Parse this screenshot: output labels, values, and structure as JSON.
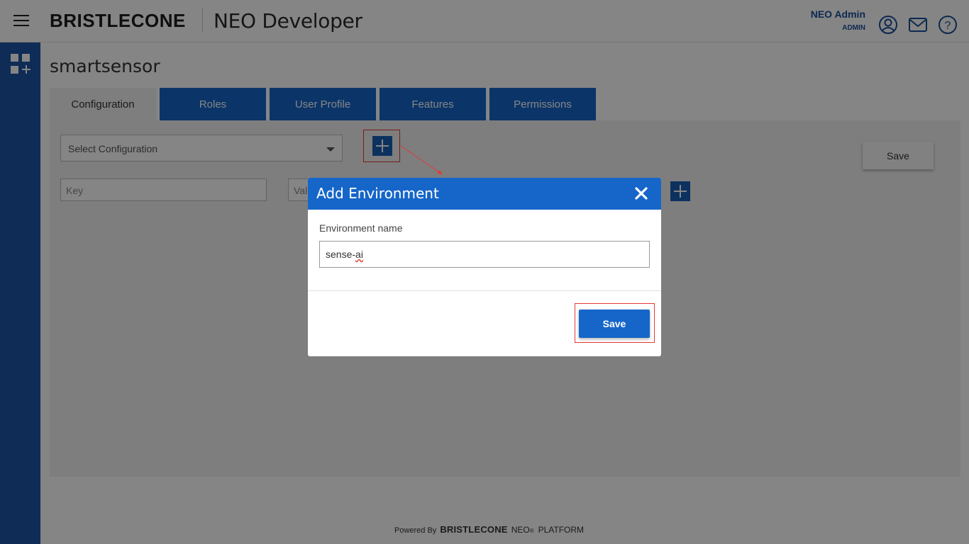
{
  "header": {
    "logo_text": "BRISTLECONE",
    "app_title": "NEO Developer",
    "user_name": "NEO Admin",
    "user_role": "ADMIN"
  },
  "page": {
    "title": "smartsensor",
    "tabs": [
      {
        "label": "Configuration",
        "active": true
      },
      {
        "label": "Roles",
        "active": false
      },
      {
        "label": "User Profile",
        "active": false
      },
      {
        "label": "Features",
        "active": false
      },
      {
        "label": "Permissions",
        "active": false
      }
    ],
    "select_placeholder": "Select Configuration",
    "save_label": "Save",
    "key_placeholder": "Key",
    "value_placeholder": "Val"
  },
  "modal": {
    "title": "Add Environment",
    "field_label": "Environment name",
    "field_value_prefix": "sense-",
    "field_value_misspelled": "ai",
    "save_label": "Save"
  },
  "footer": {
    "powered_by": "Powered By",
    "brand": "BRISTLECONE",
    "neo": "NEO",
    "registered": "®",
    "platform": "PLATFORM"
  },
  "colors": {
    "primary": "#1666c9",
    "sidebar": "#1b55a5",
    "highlight": "#e53935"
  }
}
